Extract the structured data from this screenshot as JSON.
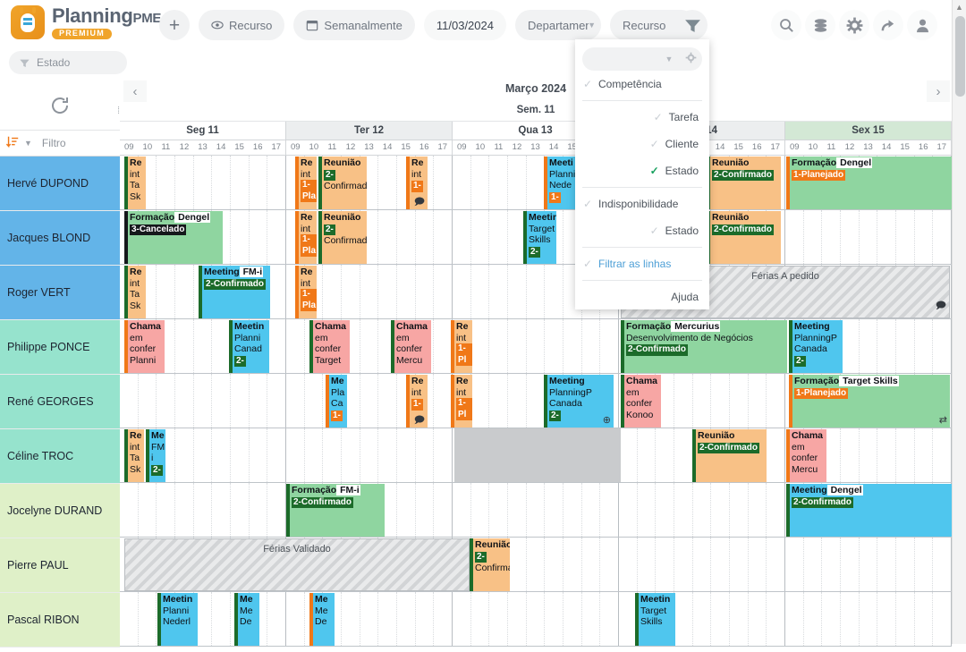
{
  "app": {
    "brand_name": "Planning",
    "brand_suffix": "PME",
    "brand_badge": "PREMIUM",
    "accent": "#f0a42a"
  },
  "toolbar": {
    "add_label": "+",
    "view_label": "Recurso",
    "view_icon": "eye-icon",
    "period_label": "Semanalmente",
    "period_icon": "calendar-icon",
    "date_value": "11/03/2024",
    "department_label": "Departamento",
    "resource_label": "Recurso",
    "filter_icon": "funnel-icon",
    "right_icons": [
      "search-icon",
      "database-icon",
      "gear-icon",
      "share-icon",
      "user-icon"
    ],
    "status_filter_label": "Estado",
    "status_filter_icon": "funnel-icon"
  },
  "dropdown": {
    "search_value": "",
    "gear_icon": "gear-icon",
    "items": [
      {
        "label": "Competência",
        "checked": false,
        "align": "left",
        "style": "normal"
      },
      {
        "label": "Tarefa",
        "checked": false,
        "align": "right",
        "style": "normal"
      },
      {
        "label": "Cliente",
        "checked": false,
        "align": "right",
        "style": "normal"
      },
      {
        "label": "Estado",
        "checked": true,
        "align": "right",
        "style": "normal"
      },
      {
        "label": "Indisponibilidade",
        "checked": false,
        "align": "left",
        "style": "normal"
      },
      {
        "label": "Estado",
        "checked": false,
        "align": "right",
        "style": "normal"
      },
      {
        "label": "Filtrar as linhas",
        "checked": false,
        "align": "left",
        "style": "blue"
      },
      {
        "label": "Ajuda",
        "checked": false,
        "align": "right",
        "style": "plain"
      }
    ]
  },
  "left_panel": {
    "refresh_icon": "refresh-icon",
    "sort_icon": "sort-icon",
    "filter_placeholder": "Filtro"
  },
  "calendar": {
    "month_label": "Março 2024",
    "week_label": "Sem. 11",
    "prev_icon": "chevron-left-icon",
    "next_icon": "chevron-right-icon",
    "hours": [
      "09",
      "10",
      "11",
      "12",
      "13",
      "14",
      "15",
      "16",
      "17"
    ],
    "days": [
      {
        "label": "Seg 11",
        "shade": "plain"
      },
      {
        "label": "Ter 12",
        "shade": "alt"
      },
      {
        "label": "Qua 13",
        "shade": "plain"
      },
      {
        "label": "Qui 14",
        "shade": "alt"
      },
      {
        "label": "Sex 15",
        "shade": "highlight"
      }
    ]
  },
  "resources": [
    {
      "name": "Hervé DUPOND",
      "group_color": "#63b4e8"
    },
    {
      "name": "Jacques BLOND",
      "group_color": "#63b4e8"
    },
    {
      "name": "Roger VERT",
      "group_color": "#63b4e8"
    },
    {
      "name": "Philippe PONCE",
      "group_color": "#96e3cd"
    },
    {
      "name": "René GEORGES",
      "group_color": "#96e3cd"
    },
    {
      "name": "Céline TROC",
      "group_color": "#96e3cd"
    },
    {
      "name": "Jocelyne DURAND",
      "group_color": "#dff0c8"
    },
    {
      "name": "Pierre PAUL",
      "group_color": "#dff0c8"
    },
    {
      "name": "Pascal RIBON",
      "group_color": "#dff0c8"
    }
  ],
  "events": {
    "status_labels": {
      "planned": "1-Planejado",
      "confirmed": "2-Confirmado",
      "cancelled": "3-Cancelado"
    },
    "rows": [
      [
        {
          "title": "Reunião de inicio",
          "lines": [
            "Re",
            "int",
            "Ta",
            "Sk"
          ],
          "status": "",
          "bg": "bg-orange",
          "bar": "bl-green"
        },
        {
          "title": "Reunião de inicio",
          "lines": [
            "Re",
            "int"
          ],
          "status": "1-Pla",
          "bg": "bg-orange",
          "bar": "bl-orange"
        },
        {
          "title": "Reunião",
          "lines": [
            "Reunião",
            "2-",
            "Confirmado"
          ],
          "status": "",
          "bg": "bg-orange",
          "bar": "bl-green"
        },
        {
          "title": "Reunião de inicio",
          "lines": [
            "Re",
            "int"
          ],
          "status": "1-",
          "bg": "bg-orange",
          "bar": "bl-orange",
          "icon": "comment-icon"
        },
        {
          "title": "Meeting PlanningPME Nederland",
          "lines": [
            "Meeti",
            "Planni",
            "Nede"
          ],
          "status": "1-",
          "bg": "bg-cyan",
          "bar": "bl-orange"
        },
        {
          "title": "Reunião",
          "lines": [
            "Reunião",
            "2-Confirmado"
          ],
          "status": "",
          "bg": "bg-orange",
          "bar": "bl-green"
        },
        {
          "title": "Formação Dengel",
          "lines": [
            "Formação Dengel",
            "1-Planejado"
          ],
          "status": "",
          "bg": "bg-green",
          "bar": "bl-orange"
        }
      ],
      [
        {
          "title": "Formação Dengel",
          "lines": [
            "Formação Dengel",
            "3-Cancelado"
          ],
          "status": "",
          "bg": "bg-green",
          "bar": "bl-dark"
        },
        {
          "title": "Reunião de inicio",
          "lines": [
            "Re",
            "int"
          ],
          "status": "1-Pla",
          "bg": "bg-orange",
          "bar": "bl-orange"
        },
        {
          "title": "Reunião",
          "lines": [
            "Reunião",
            "2-",
            "Confirmado"
          ],
          "status": "",
          "bg": "bg-orange",
          "bar": "bl-green"
        },
        {
          "title": "Meeting Target Skills",
          "lines": [
            "Meeting",
            "Target",
            "Skills",
            "2-"
          ],
          "status": "",
          "bg": "bg-cyan",
          "bar": "bl-green"
        },
        {
          "title": "Reunião",
          "lines": [
            "Reunião",
            "2-Confirmado"
          ],
          "status": "",
          "bg": "bg-orange",
          "bar": "bl-green"
        }
      ],
      [
        {
          "title": "Reunião de inicio",
          "lines": [
            "Re",
            "int",
            "Ta",
            "Sk"
          ],
          "status": "",
          "bg": "bg-orange",
          "bar": "bl-green"
        },
        {
          "title": "Meeting FM-i",
          "lines": [
            "Meeting FM-i",
            "2-Confirmado"
          ],
          "status": "",
          "bg": "bg-cyan",
          "bar": "bl-green"
        },
        {
          "title": "Reunião de inicio",
          "lines": [
            "Re",
            "int"
          ],
          "status": "1-Pla",
          "bg": "bg-orange",
          "bar": "bl-orange"
        },
        {
          "title": "Férias A pedido",
          "type": "holiday",
          "label": "Férias A pedido",
          "icon": "comment-icon"
        }
      ],
      [
        {
          "title": "Chamada em conferência PlanningPME",
          "lines": [
            "Chama",
            "em",
            "confer",
            "Planni"
          ],
          "status": "",
          "bg": "bg-pink",
          "bar": "bl-orange"
        },
        {
          "title": "Meeting PlanningPME Canada",
          "lines": [
            "Meetin",
            "Planni",
            "Canad",
            "2-"
          ],
          "status": "",
          "bg": "bg-cyan",
          "bar": "bl-green"
        },
        {
          "title": "Chamada em conferência Target",
          "lines": [
            "Chama",
            "em",
            "confer",
            "Target"
          ],
          "status": "",
          "bg": "bg-pink",
          "bar": "bl-green"
        },
        {
          "title": "Chamada em conferência Mercurius",
          "lines": [
            "Chama",
            "em",
            "confer",
            "Mercu"
          ],
          "status": "",
          "bg": "bg-pink",
          "bar": "bl-green"
        },
        {
          "title": "Reunião de inicio",
          "lines": [
            "Re",
            "int"
          ],
          "status": "1-Pl",
          "bg": "bg-orange",
          "bar": "bl-orange"
        },
        {
          "title": "Formação Mercurius Desenvolvimento de Negócios",
          "lines": [
            "Formação Mercurius",
            "Desenvolvimento de Negócios",
            "2-Confirmado"
          ],
          "status": "",
          "bg": "bg-green",
          "bar": "bl-green"
        },
        {
          "title": "Meeting PlanningPME Canada",
          "lines": [
            "Meeting",
            "PlanningP",
            "Canada",
            "2-"
          ],
          "status": "",
          "bg": "bg-cyan",
          "bar": "bl-green"
        }
      ],
      [
        {
          "title": "Meeting PlanningPME Canada",
          "lines": [
            "Me",
            "Pla",
            "Ca",
            "1-"
          ],
          "status": "",
          "bg": "bg-cyan",
          "bar": "bl-orange"
        },
        {
          "title": "Reunião de inicio",
          "lines": [
            "Re",
            "int"
          ],
          "status": "1-",
          "bg": "bg-orange",
          "bar": "bl-orange",
          "icon": "comment-icon"
        },
        {
          "title": "Reunião de inicio",
          "lines": [
            "Re",
            "int"
          ],
          "status": "1-Pl",
          "bg": "bg-orange",
          "bar": "bl-orange"
        },
        {
          "title": "Meeting PlanningPME Canada",
          "lines": [
            "Meeting",
            "PlanningP",
            "Canada",
            "2-"
          ],
          "status": "",
          "bg": "bg-cyan",
          "bar": "bl-green",
          "icon": "plus-circle-icon"
        },
        {
          "title": "Chamada em conferência Konoo",
          "lines": [
            "Chama",
            "em",
            "confer",
            "Konoo"
          ],
          "status": "",
          "bg": "bg-pink",
          "bar": "bl-green"
        },
        {
          "title": "Formação Target Skills",
          "lines": [
            "Formação Target Skills",
            "1-Planejado"
          ],
          "status": "",
          "bg": "bg-green",
          "bar": "bl-orange",
          "icon": "repeat-icon"
        }
      ],
      [
        {
          "title": "Reunião de inicio",
          "lines": [
            "Re",
            "int",
            "Ta",
            "Sk"
          ],
          "status": "",
          "bg": "bg-orange",
          "bar": "bl-green"
        },
        {
          "title": "Meeting FM-i",
          "lines": [
            "Me",
            "FM",
            "i",
            "2-"
          ],
          "status": "",
          "bg": "bg-cyan",
          "bar": "bl-green"
        },
        {
          "title": "Reunião",
          "lines": [
            "Reunião",
            "2-Confirmado"
          ],
          "status": "",
          "bg": "bg-orange",
          "bar": "bl-green"
        },
        {
          "title": "Chamada em conferência Mercurius",
          "lines": [
            "Chama",
            "em",
            "confer",
            "Mercu"
          ],
          "status": "",
          "bg": "bg-pink",
          "bar": "bl-orange"
        }
      ],
      [
        {
          "title": "Formação FM-i",
          "lines": [
            "Formação FM-i",
            "2-Confirmado"
          ],
          "status": "",
          "bg": "bg-green",
          "bar": "bl-green"
        },
        {
          "title": "Meeting Dengel",
          "lines": [
            "Meeting Dengel",
            "2-Confirmado"
          ],
          "status": "",
          "bg": "bg-cyan",
          "bar": "bl-green"
        }
      ],
      [
        {
          "title": "Férias Validado",
          "type": "holiday",
          "label": "Férias Validado"
        },
        {
          "title": "Reunião",
          "lines": [
            "Reunião",
            "2-",
            "Confirmado"
          ],
          "status": "",
          "bg": "bg-orange",
          "bar": "bl-green"
        }
      ],
      [
        {
          "title": "Meeting PlanningPME Nederland",
          "lines": [
            "Meetin",
            "Planni",
            "Nederl"
          ],
          "status": "",
          "bg": "bg-cyan",
          "bar": "bl-green"
        },
        {
          "title": "Meeting Mercurius Desenvolvimento",
          "lines": [
            "Me",
            "Me",
            "De"
          ],
          "status": "",
          "bg": "bg-cyan",
          "bar": "bl-green"
        },
        {
          "title": "Meeting Mercurius Desenvolvimento",
          "lines": [
            "Me",
            "Me",
            "De"
          ],
          "status": "",
          "bg": "bg-cyan",
          "bar": "bl-orange"
        },
        {
          "title": "Meeting Target Skills",
          "lines": [
            "Meetin",
            "Target",
            "Skills"
          ],
          "status": "",
          "bg": "bg-cyan",
          "bar": "bl-green"
        }
      ]
    ]
  },
  "scrollbar": {
    "up_icon": "triangle-up-icon",
    "down_icon": "triangle-down-icon"
  }
}
